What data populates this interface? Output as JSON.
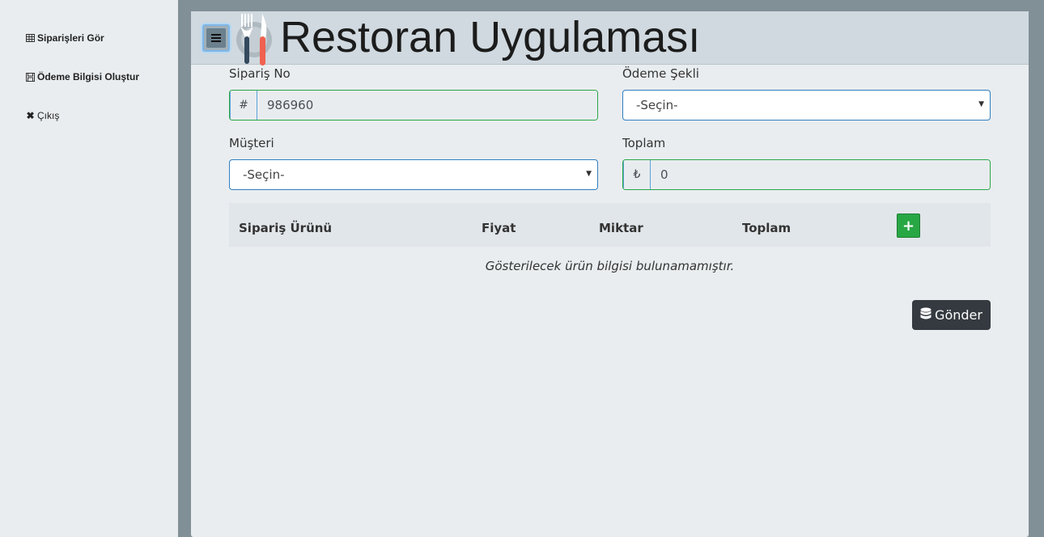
{
  "sidebar": {
    "items": [
      {
        "label": "Siparişleri Gör",
        "icon": "table-icon"
      },
      {
        "label": "Ödeme Bilgisi Oluştur",
        "icon": "save-icon"
      },
      {
        "label": "Çıkış",
        "icon": "close-icon"
      }
    ]
  },
  "header": {
    "title": "Restoran Uygulaması",
    "menu_icon": "menu-icon",
    "logo_icon": "fork-knife-icon"
  },
  "form": {
    "order_no": {
      "label": "Sipariş No",
      "prefix": "#",
      "value": "986960"
    },
    "payment": {
      "label": "Ödeme Şekli",
      "selected": "-Seçin-"
    },
    "customer": {
      "label": "Müşteri",
      "selected": "-Seçin-"
    },
    "total": {
      "label": "Toplam",
      "prefix": "₺",
      "value": "0"
    }
  },
  "table": {
    "columns": [
      "Sipariş Ürünü",
      "Fiyat",
      "Miktar",
      "Toplam"
    ],
    "add_label": "+",
    "empty_message": "Gösterilecek ürün bilgisi bulunamamıştır."
  },
  "submit": {
    "label": "Gönder",
    "icon": "database-icon"
  },
  "colors": {
    "success": "#28a745",
    "dark": "#343a40",
    "frame": "#818f97",
    "focus": "#2f7fc1"
  }
}
